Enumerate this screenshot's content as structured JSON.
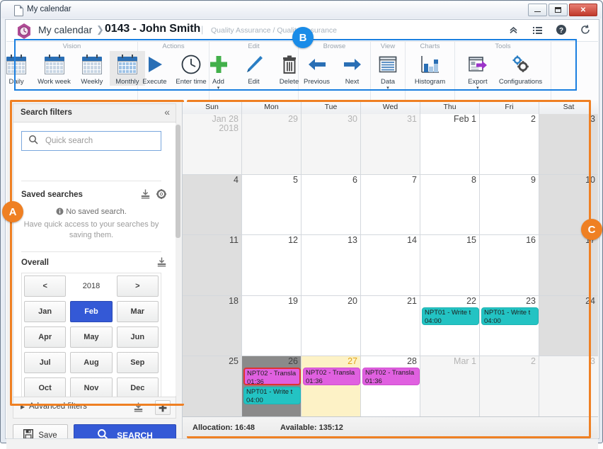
{
  "window": {
    "title": "My calendar",
    "buttons": {
      "minimize": "minimize",
      "maximize": "maximize",
      "close": "✕"
    }
  },
  "breadcrumb": {
    "root": "My calendar",
    "separator": "❯",
    "main": "0143 - John Smith",
    "pipe": "|",
    "sub": "Quality Assurance / Quality Assurance",
    "tools": [
      {
        "name": "collapse-ribbon-icon",
        "glyph": "⌃"
      },
      {
        "name": "list-menu-icon",
        "glyph": "☰"
      },
      {
        "name": "help-icon",
        "glyph": "?"
      },
      {
        "name": "refresh-icon",
        "glyph": "⟳"
      }
    ]
  },
  "ribbon": {
    "groups": [
      {
        "title": "Vision",
        "items": [
          {
            "label": "Daily",
            "icon": "calendar-daily-icon",
            "selected": false
          },
          {
            "label": "Work week",
            "icon": "calendar-workweek-icon",
            "selected": false
          },
          {
            "label": "Weekly",
            "icon": "calendar-weekly-icon",
            "selected": false
          },
          {
            "label": "Monthly",
            "icon": "calendar-monthly-icon",
            "selected": true
          }
        ]
      },
      {
        "title": "Actions",
        "items": [
          {
            "label": "Execute",
            "icon": "play-icon",
            "selected": false
          },
          {
            "label": "Enter time",
            "icon": "clock-icon",
            "selected": false
          }
        ]
      },
      {
        "title": "Edit",
        "items": [
          {
            "label": "Add",
            "icon": "plus-icon",
            "caret": "▾",
            "selected": false
          },
          {
            "label": "Edit",
            "icon": "pencil-icon",
            "selected": false
          },
          {
            "label": "Delete",
            "icon": "trash-icon",
            "selected": false
          }
        ]
      },
      {
        "title": "Browse",
        "items": [
          {
            "label": "Previous",
            "icon": "arrow-left-icon",
            "selected": false
          },
          {
            "label": "Next",
            "icon": "arrow-right-icon",
            "selected": false
          }
        ]
      },
      {
        "title": "View",
        "items": [
          {
            "label": "Data",
            "icon": "data-grid-icon",
            "caret": "▾",
            "selected": false
          }
        ]
      },
      {
        "title": "Charts",
        "items": [
          {
            "label": "Histogram",
            "icon": "histogram-icon",
            "selected": false
          }
        ]
      },
      {
        "title": "Tools",
        "items": [
          {
            "label": "Export",
            "icon": "export-icon",
            "caret": "▾",
            "selected": false
          },
          {
            "label": "Configurations",
            "icon": "gears-icon",
            "selected": false
          }
        ]
      }
    ]
  },
  "sidebar": {
    "header": "Search filters",
    "collapse_glyph": "«",
    "quick_search": {
      "placeholder": "Quick search",
      "value": ""
    },
    "saved_searches": {
      "title": "Saved searches",
      "empty_title": "No saved search.",
      "empty_sub": "Have quick access to your searches by saving them."
    },
    "overall": {
      "title": "Overall",
      "prev": "<",
      "year": "2018",
      "next": ">",
      "months": [
        "Jan",
        "Feb",
        "Mar",
        "Apr",
        "May",
        "Jun",
        "Jul",
        "Aug",
        "Sep",
        "Oct",
        "Nov",
        "Dec"
      ],
      "selected_month": "Feb"
    },
    "advanced_filters": {
      "label": "Advanced filters",
      "triangle": "▶",
      "plus": "✚"
    },
    "footer": {
      "save": "Save",
      "search": "SEARCH"
    }
  },
  "calendar": {
    "day_headers": [
      "Sun",
      "Mon",
      "Tue",
      "Wed",
      "Thu",
      "Fri",
      "Sat"
    ],
    "weeks": [
      [
        {
          "num": "Jan 28",
          "year": "2018",
          "state": "out"
        },
        {
          "num": "29",
          "state": "out"
        },
        {
          "num": "30",
          "state": "out"
        },
        {
          "num": "31",
          "state": "out"
        },
        {
          "num": "Feb 1",
          "state": "normal"
        },
        {
          "num": "2",
          "state": "normal"
        },
        {
          "num": "3",
          "state": "weekend"
        }
      ],
      [
        {
          "num": "4",
          "state": "weekend"
        },
        {
          "num": "5",
          "state": "normal"
        },
        {
          "num": "6",
          "state": "normal"
        },
        {
          "num": "7",
          "state": "normal"
        },
        {
          "num": "8",
          "state": "normal"
        },
        {
          "num": "9",
          "state": "normal"
        },
        {
          "num": "10",
          "state": "weekend"
        }
      ],
      [
        {
          "num": "11",
          "state": "weekend"
        },
        {
          "num": "12",
          "state": "normal"
        },
        {
          "num": "13",
          "state": "normal"
        },
        {
          "num": "14",
          "state": "normal"
        },
        {
          "num": "15",
          "state": "normal"
        },
        {
          "num": "16",
          "state": "normal"
        },
        {
          "num": "17",
          "state": "weekend"
        }
      ],
      [
        {
          "num": "18",
          "state": "weekend"
        },
        {
          "num": "19",
          "state": "normal"
        },
        {
          "num": "20",
          "state": "normal"
        },
        {
          "num": "21",
          "state": "normal"
        },
        {
          "num": "22",
          "state": "normal",
          "events": [
            {
              "title": "NPT01 - Write t",
              "time": "04:00",
              "color": "teal"
            }
          ]
        },
        {
          "num": "23",
          "state": "normal",
          "events": [
            {
              "title": "NPT01 - Write t",
              "time": "04:00",
              "color": "teal"
            }
          ]
        },
        {
          "num": "24",
          "state": "weekend"
        }
      ],
      [
        {
          "num": "25",
          "state": "weekend"
        },
        {
          "num": "26",
          "state": "selected",
          "events": [
            {
              "title": "NPT02 - Transla",
              "time": "01:36",
              "color": "magenta",
              "highlighted": true
            },
            {
              "title": "NPT01 - Write t",
              "time": "04:00",
              "color": "teal"
            }
          ]
        },
        {
          "num": "27",
          "state": "today",
          "events": [
            {
              "title": "NPT02 - Transla",
              "time": "01:36",
              "color": "magenta"
            }
          ]
        },
        {
          "num": "28",
          "state": "normal",
          "events": [
            {
              "title": "NPT02 - Transla",
              "time": "01:36",
              "color": "magenta"
            }
          ]
        },
        {
          "num": "Mar 1",
          "state": "out"
        },
        {
          "num": "2",
          "state": "out"
        },
        {
          "num": "3",
          "state": "out"
        }
      ]
    ],
    "status": {
      "allocation": "Allocation: 16:48",
      "available": "Available: 135:12"
    }
  },
  "annotations": [
    {
      "label": "A",
      "color": "#ef8023"
    },
    {
      "label": "B",
      "color": "#1a8ce8"
    },
    {
      "label": "C",
      "color": "#ef8023"
    }
  ]
}
